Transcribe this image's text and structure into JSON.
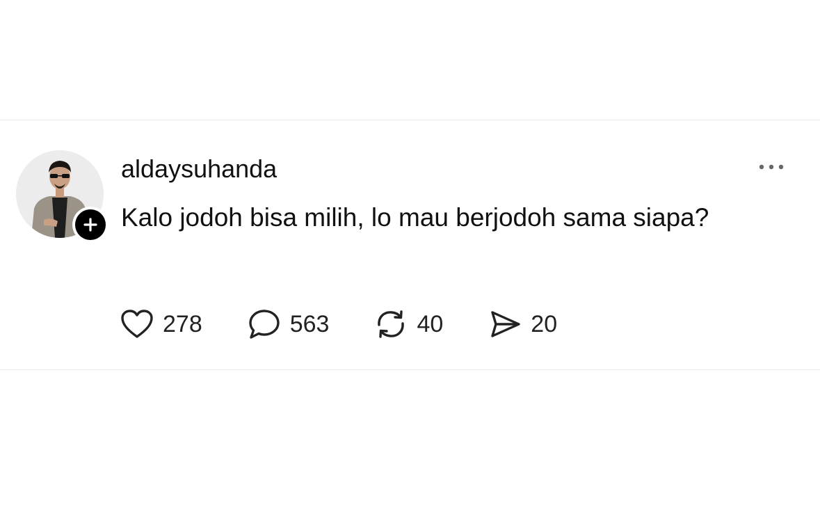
{
  "post": {
    "username": "aldaysuhanda",
    "text": "Kalo jodoh bisa milih, lo mau berjodoh sama siapa?",
    "more_icon": "more-horizontal-icon",
    "follow_icon": "plus-icon",
    "actions": {
      "likes": {
        "icon": "heart-icon",
        "count": "278"
      },
      "replies": {
        "icon": "comment-icon",
        "count": "563"
      },
      "reposts": {
        "icon": "repost-icon",
        "count": "40"
      },
      "shares": {
        "icon": "send-icon",
        "count": "20"
      }
    }
  },
  "colors": {
    "text": "#111111",
    "background": "#ffffff",
    "divider": "#ececec",
    "badge": "#000000",
    "icon": "#222222"
  }
}
